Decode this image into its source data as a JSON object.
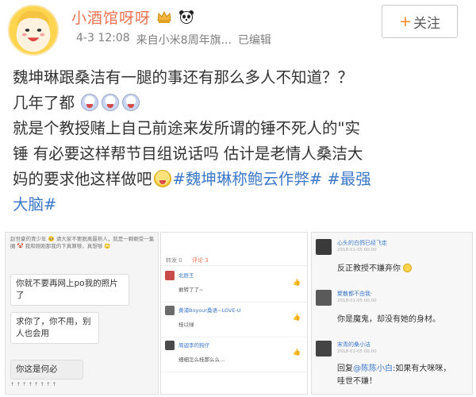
{
  "post": {
    "username": "小酒馆呀呀",
    "time": "4-3 12:08",
    "source": "来自小米8周年旗...",
    "edited": "已编辑",
    "follow_label": "关注",
    "follow_plus": "+",
    "text_lines": [
      "魏坤琳跟桑洁有一腿的事还有那么多人不知道？？",
      "几年了都",
      "就是个教授赌上自己前途来发所谓的锤不死人的\"实",
      "锤 有必要这样帮节目组说话吗 估计是老情人桑洁大",
      "妈的要求他这样做吧"
    ],
    "tag1": "#魏坤琳称鲍云作弊#",
    "tag2_part1": "#最强",
    "tag2_part2": "大脑#"
  },
  "panel1": {
    "top_note": "赵世豪的青少年 🥺 请大家不要脱离最熟人，就是一颗颗受一集圈 🤡 我和刚刚那我的下真算够，真想够 🙄",
    "bubble1": "你就不要再网上po我的照片了",
    "bubble2": "求你了，你不用，别人也会用",
    "bubble3": "你这是何必",
    "bottom_note": "↑ ↑ ↑ ↑ ↑ ↑ ↑ ↑"
  },
  "panel2": {
    "tabs": "转发 0",
    "tab_active": "评论 3",
    "comments": [
      {
        "name": "北辰王",
        "text": "敢转了了~"
      },
      {
        "name": "黄浦Boyour桑语~LOVE-U",
        "text": "桂以绿"
      },
      {
        "name": "周迦李的狗仔",
        "text": "细细怎么桂那么么..."
      }
    ],
    "like_icon": "thumb-up-icon"
  },
  "panel3": {
    "comments": [
      {
        "name": "心头的白鸽已经飞走",
        "sub": "2018-01-05 00:00",
        "text": "反正教授不嫌弃你"
      },
      {
        "name": "聚散都不由我·",
        "sub": "2018-01-05 00:00",
        "text": "你是魔鬼，却没有她的身材。"
      },
      {
        "name": "宋青的桑小洁",
        "sub": "2018-01-05 00:00",
        "text_prefix": "回复",
        "mention": "@陈陈小白",
        "text_suffix": ":如果有大咪咪，",
        "text_line2": "哇世不嫌！"
      }
    ]
  }
}
